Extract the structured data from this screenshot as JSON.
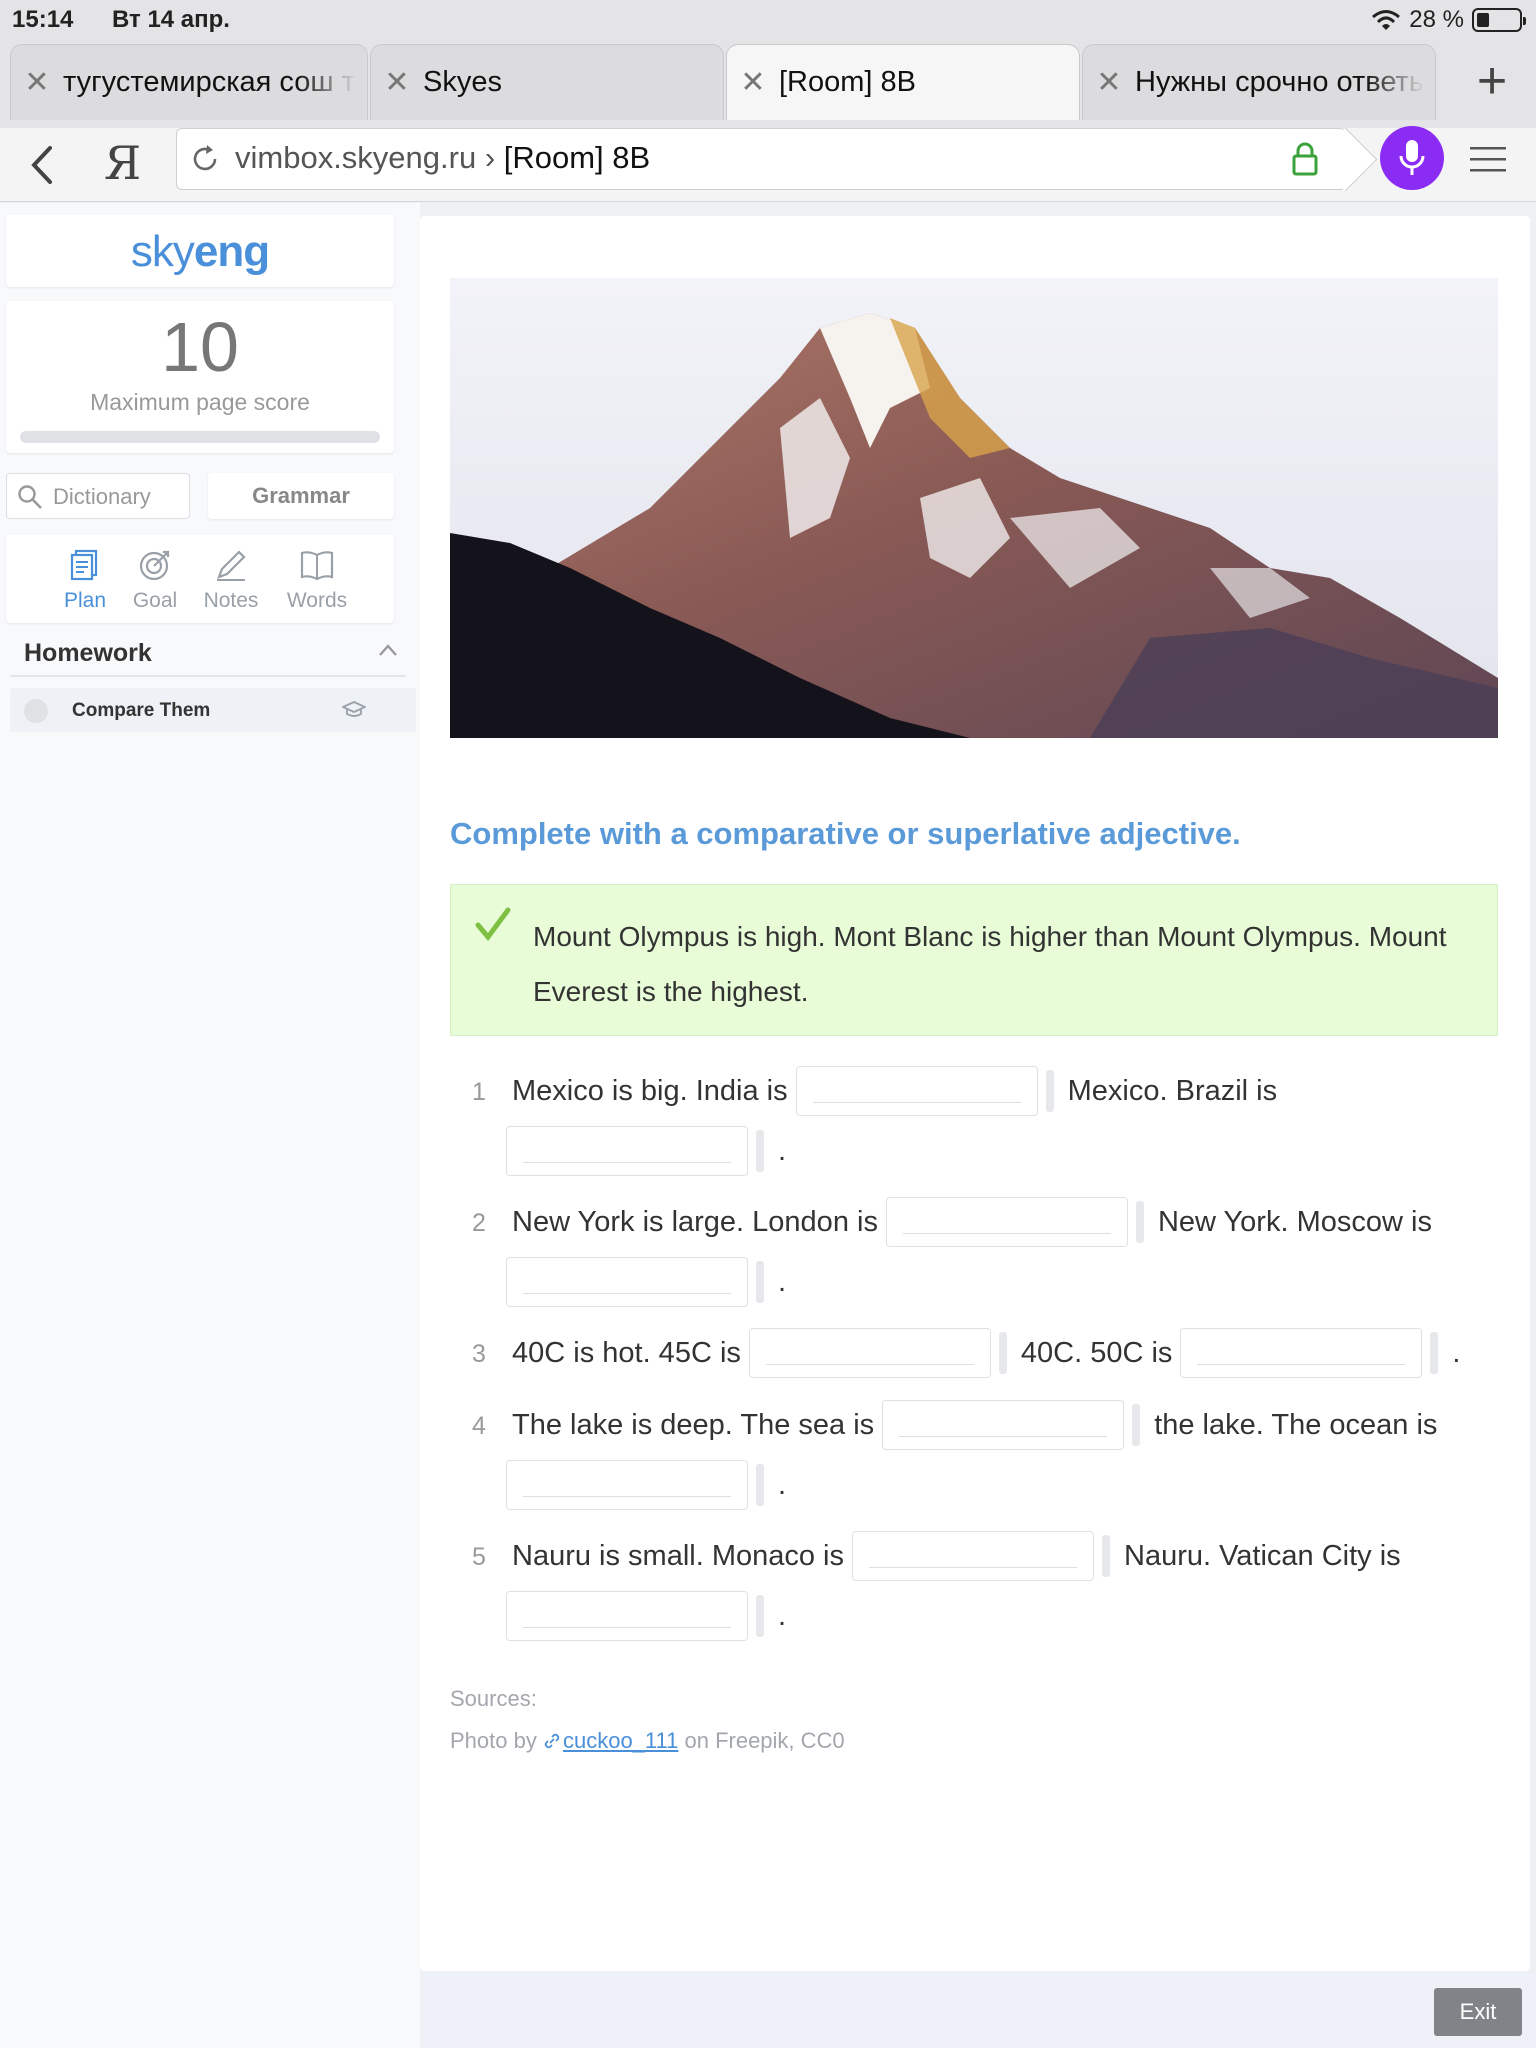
{
  "status": {
    "time": "15:14",
    "date": "Вт 14 апр.",
    "battery": "28 %"
  },
  "tabs": [
    {
      "label": "тугустемирская сош т",
      "active": false
    },
    {
      "label": "Skyes",
      "active": false
    },
    {
      "label": "[Room] 8B",
      "active": true
    },
    {
      "label": "Нужны срочно ответы",
      "active": false
    }
  ],
  "address": {
    "domain": "vimbox.skyeng.ru ›",
    "page": " [Room] 8B",
    "ya": "Я"
  },
  "sidebar": {
    "logo_sky": "sky",
    "logo_eng": "eng",
    "score": "10",
    "score_label": "Maximum page score",
    "score_progress": 0,
    "dictionary_placeholder": "Dictionary",
    "grammar_label": "Grammar",
    "tools": [
      "Plan",
      "Goal",
      "Notes",
      "Words"
    ],
    "homework_title": "Homework",
    "lesson_title": "Compare Them"
  },
  "main": {
    "task_title": "Complete with a comparative or superlative adjective.",
    "example": "Mount Olympus is high. Mont Blanc is higher than Mount Olympus. Mount Everest is the highest.",
    "exercises": [
      {
        "num": "1",
        "a": "Mexico is big. India is",
        "b": "Mexico. Brazil is",
        "end": "."
      },
      {
        "num": "2",
        "a": "New York is large. London is",
        "b": "New York. Moscow is",
        "end": "."
      },
      {
        "num": "3",
        "a": "40C is hot. 45C is",
        "b": "40C. 50C is",
        "end": "."
      },
      {
        "num": "4",
        "a": "The lake is deep. The sea is",
        "b": "the lake. The ocean is",
        "end": "."
      },
      {
        "num": "5",
        "a": "Nauru is small. Monaco is",
        "b": "Nauru. Vatican City is",
        "end": "."
      }
    ],
    "sources_label": "Sources:",
    "credit_prefix": "Photo by",
    "credit_author": "cuckoo_111",
    "credit_suffix": "on Freepik, CC0"
  },
  "footer": {
    "exit_label": "Exit"
  },
  "colors": {
    "accent": "#4a8fd9",
    "mic": "#8b2cf5",
    "example_bg": "#e8fcd8",
    "check": "#7ec142"
  }
}
